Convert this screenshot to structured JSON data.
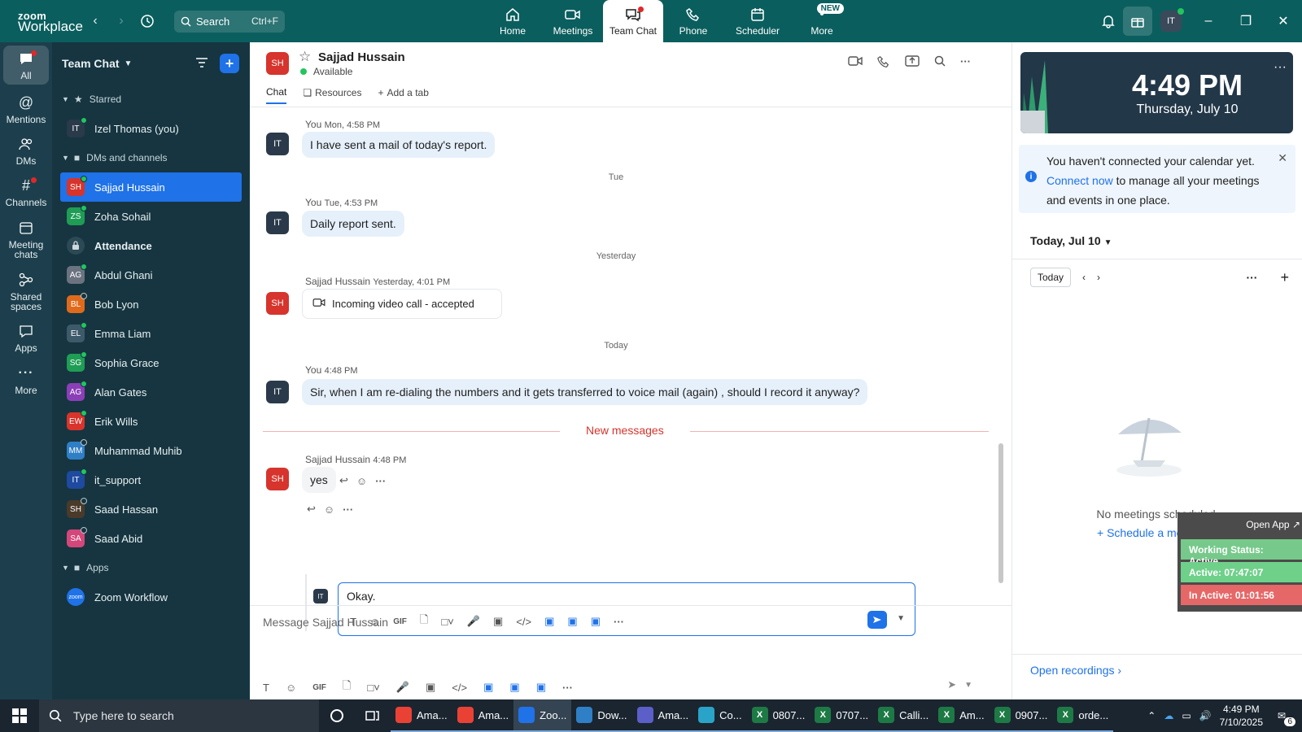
{
  "app": {
    "brand_line1": "zoom",
    "brand_line2": "Workplace"
  },
  "topbar": {
    "search_label": "Search",
    "search_shortcut": "Ctrl+F",
    "tabs": [
      {
        "label": "Home",
        "icon": "home-icon"
      },
      {
        "label": "Meetings",
        "icon": "video-camera-icon"
      },
      {
        "label": "Team Chat",
        "icon": "chat-icon"
      },
      {
        "label": "Phone",
        "icon": "phone-icon"
      },
      {
        "label": "Scheduler",
        "icon": "calendar-icon"
      },
      {
        "label": "More",
        "icon": "more-icon",
        "badge": "NEW"
      }
    ],
    "active_tab": "Team Chat",
    "user_initials": "IT",
    "accent": "#0b5e5e"
  },
  "rail": {
    "items": [
      {
        "label": "All",
        "icon": "chat-bubble-icon"
      },
      {
        "label": "Mentions",
        "icon": "at-icon"
      },
      {
        "label": "DMs",
        "icon": "people-icon"
      },
      {
        "label": "Channels",
        "icon": "hashtag-icon"
      },
      {
        "label": "Meeting chats",
        "icon": "calendar-icon"
      },
      {
        "label": "Shared spaces",
        "icon": "share-icon"
      },
      {
        "label": "Apps",
        "icon": "apps-icon"
      },
      {
        "label": "More",
        "icon": "ellipsis-icon"
      }
    ]
  },
  "sidebar": {
    "title": "Team Chat",
    "sections": {
      "starred": "Starred",
      "dms": "DMs and channels",
      "apps": "Apps"
    },
    "starred_items": [
      {
        "initials": "IT",
        "name": "Izel Thomas (you)",
        "color": "#2a3a4a",
        "status": "online"
      }
    ],
    "items": [
      {
        "initials": "SH",
        "name": "Sajjad Hussain",
        "color": "#d6342c",
        "status": "online",
        "selected": true
      },
      {
        "initials": "ZS",
        "name": "Zoha Sohail",
        "color": "#1f9d55",
        "status": "online"
      },
      {
        "initials": "",
        "name": "Attendance",
        "color": "#2b4a56",
        "status": "lock",
        "bold": true
      },
      {
        "initials": "AG",
        "name": "Abdul Ghani",
        "color": "#6b7280",
        "status": "online"
      },
      {
        "initials": "BL",
        "name": "Bob Lyon",
        "color": "#e06a1b",
        "status": "offline"
      },
      {
        "initials": "EL",
        "name": "Emma Liam",
        "color": "#3d5a6a",
        "status": "online"
      },
      {
        "initials": "SG",
        "name": "Sophia Grace",
        "color": "#1f9d55",
        "status": "online"
      },
      {
        "initials": "AG",
        "name": "Alan Gates",
        "color": "#8b3fb7",
        "status": "online"
      },
      {
        "initials": "EW",
        "name": "Erik Wills",
        "color": "#d9342b",
        "status": "online"
      },
      {
        "initials": "MM",
        "name": "Muhammad Muhib",
        "color": "#2f7fc6",
        "status": "offline"
      },
      {
        "initials": "IT",
        "name": "it_support",
        "color": "#1e4aa0",
        "status": "online"
      },
      {
        "initials": "SH",
        "name": "Saad Hassan",
        "color": "#4a3a2a",
        "status": "offline"
      },
      {
        "initials": "SA",
        "name": "Saad Abid",
        "color": "#d4477a",
        "status": "offline"
      }
    ],
    "apps": [
      {
        "initials": "zoom",
        "name": "Zoom Workflow",
        "color": "#1f72e8"
      }
    ]
  },
  "chat": {
    "contact_initials": "SH",
    "contact_name": "Sajjad Hussain",
    "contact_status": "Available",
    "tabs": [
      "Chat",
      "Resources",
      "Add a tab"
    ],
    "messages": [
      {
        "sender": "You",
        "time": "Mon, 4:58 PM",
        "text": "I have sent a mail of today's report.",
        "avatar": "IT"
      },
      {
        "sender": "You",
        "time": "Tue, 4:53 PM",
        "text": "Daily report sent.",
        "avatar": "IT"
      },
      {
        "sender": "Sajjad Hussain",
        "time": "Yesterday, 4:01 PM",
        "text": "Incoming video call - accepted",
        "avatar": "SH"
      },
      {
        "sender": "You",
        "time": "4:48 PM",
        "text": "Sir, when I am re-dialing the numbers and it gets transferred to voice mail (again) , should I record it anyway?",
        "avatar": "IT"
      },
      {
        "sender": "Sajjad Hussain",
        "time": "4:48 PM",
        "text": "yes",
        "avatar": "SH"
      }
    ],
    "day_separators": [
      "Tue",
      "Yesterday",
      "Today"
    ],
    "new_messages_label": "New messages",
    "reply_text": "Okay.",
    "composer_placeholder": "Message Sajjad Hussain",
    "gif_label": "GIF"
  },
  "calendar": {
    "time": "4:49 PM",
    "date": "Thursday, July 10",
    "note_before": "You haven't connected your calendar yet.",
    "note_link": "Connect now",
    "note_after": "to manage all your meetings and events in one place.",
    "day_header": "Today, Jul 10",
    "today_btn": "Today",
    "empty_text": "No meetings scheduled.",
    "schedule_link": "Schedule a meeting",
    "open_recordings": "Open recordings"
  },
  "widget": {
    "open_app": "Open App",
    "working_status": "Working Status: Active",
    "active": "Active: 07:47:07",
    "inactive": "In Active: 01:01:56"
  },
  "taskbar": {
    "search_placeholder": "Type here to search",
    "apps": [
      {
        "label": "Ama...",
        "icon": "chrome-icon",
        "color": "#e94235"
      },
      {
        "label": "Ama...",
        "icon": "chrome-icon",
        "color": "#e94235"
      },
      {
        "label": "Zoo...",
        "icon": "zoom-icon",
        "color": "#1f72e8",
        "active": true
      },
      {
        "label": "Dow...",
        "icon": "download-icon",
        "color": "#2f7fc6"
      },
      {
        "label": "Ama...",
        "icon": "teams-icon",
        "color": "#5b5fc7"
      },
      {
        "label": "Co...",
        "icon": "edge-icon",
        "color": "#2aa3c9"
      },
      {
        "label": "0807...",
        "icon": "excel-icon",
        "color": "#1d7a45"
      },
      {
        "label": "0707...",
        "icon": "excel-icon",
        "color": "#1d7a45"
      },
      {
        "label": "Calli...",
        "icon": "excel-icon",
        "color": "#1d7a45"
      },
      {
        "label": "Am...",
        "icon": "excel-icon",
        "color": "#1d7a45"
      },
      {
        "label": "0907...",
        "icon": "excel-icon",
        "color": "#1d7a45"
      },
      {
        "label": "orde...",
        "icon": "excel-icon",
        "color": "#1d7a45"
      }
    ],
    "clock_time": "4:49 PM",
    "clock_date": "7/10/2025",
    "notif_count": "6"
  }
}
